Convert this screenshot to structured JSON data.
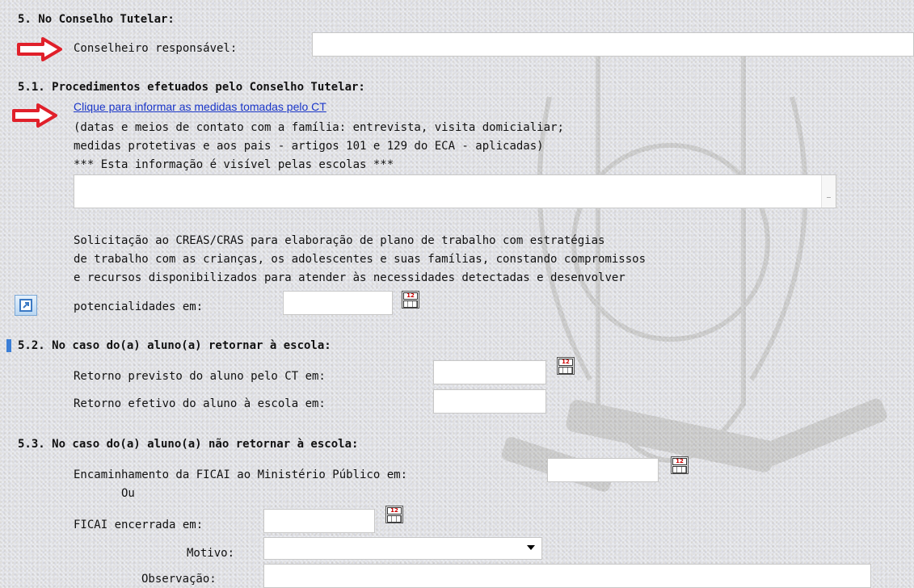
{
  "section5": {
    "title": "5. No Conselho Tutelar:",
    "conselheiro_label": "Conselheiro responsável:",
    "conselheiro_value": ""
  },
  "section51": {
    "title": "5.1. Procedimentos efetuados pelo Conselho Tutelar:",
    "link_text": "Clique para informar as medidas tomadas pelo CT",
    "desc_line1": "(datas e meios de contato com a família: entrevista, visita domicialiar;",
    "desc_line2": "medidas protetivas e aos pais - artigos 101 e 129 do ECA - aplicadas)",
    "visibility_note": "*** Esta informação é visível pelas escolas ***",
    "textarea_value": "",
    "creas_line1": "Solicitação ao CREAS/CRAS para elaboração de plano de trabalho com estratégias",
    "creas_line2": "de trabalho com as crianças, os adolescentes e suas famílias, constando compromissos",
    "creas_line3": "e recursos disponibilizados para atender às necessidades detectadas e desenvolver",
    "creas_line4": "potencialidades em:",
    "creas_date": ""
  },
  "section52": {
    "title": "5.2. No caso do(a) aluno(a) retornar à escola:",
    "previsto_label": "Retorno previsto do aluno pelo CT em:",
    "previsto_value": "",
    "efetivo_label": "Retorno efetivo do aluno à escola em:",
    "efetivo_value": ""
  },
  "section53": {
    "title": "5.3. No caso do(a) aluno(a) não retornar à escola:",
    "mp_label": "Encaminhamento da FICAI ao Ministério Público em:",
    "mp_value": "",
    "ou_label": "Ou",
    "encerrada_label": "FICAI encerrada em:",
    "encerrada_value": "",
    "motivo_label": "Motivo:",
    "motivo_value": "",
    "obs_label": "Observação:",
    "obs_value": ""
  },
  "calendar_icon": {
    "text": "12",
    "icon": "calendar-icon"
  },
  "colors": {
    "link": "#1a36c9",
    "arrow": "#e0202a",
    "bg": "#e9ebf0"
  }
}
